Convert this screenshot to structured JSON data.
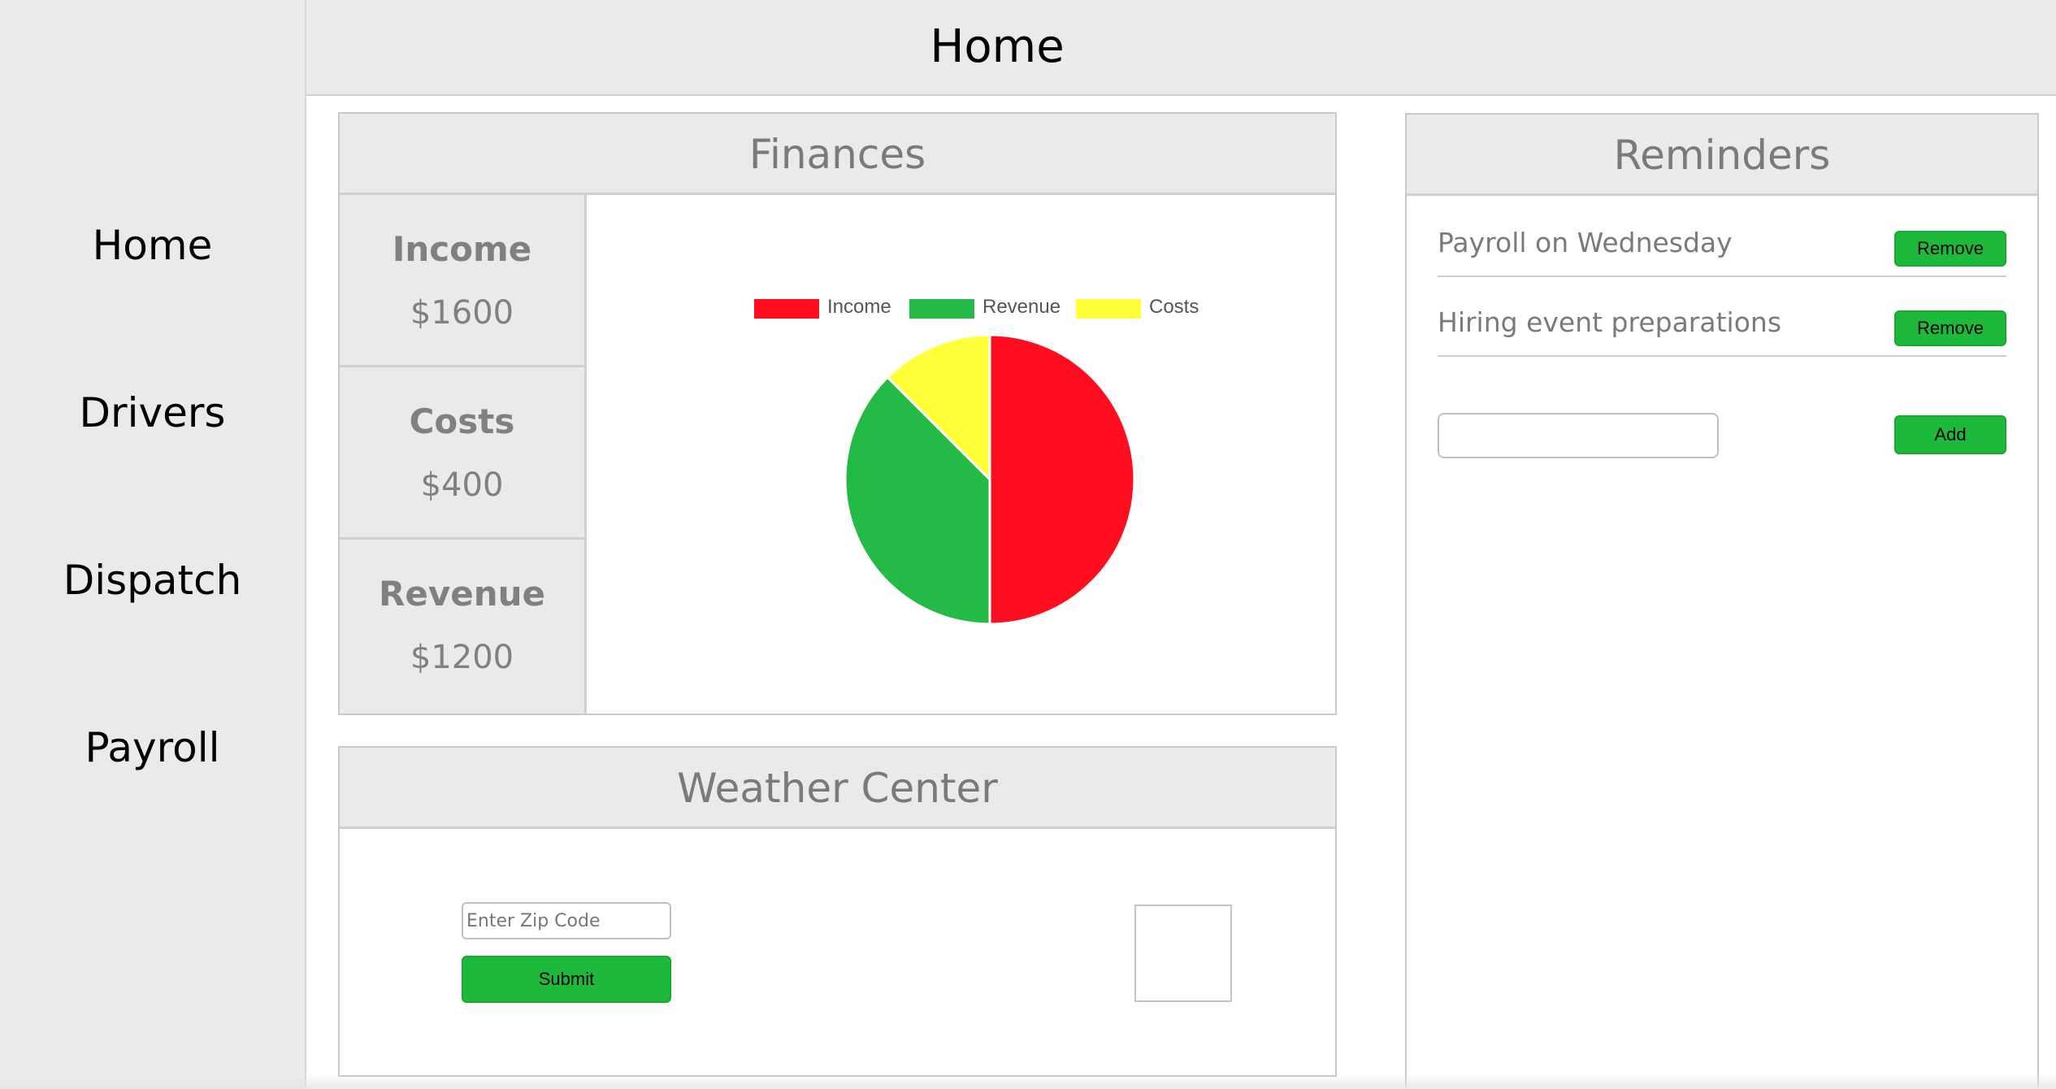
{
  "sidebar": {
    "items": [
      {
        "label": "Home"
      },
      {
        "label": "Drivers"
      },
      {
        "label": "Dispatch"
      },
      {
        "label": "Payroll"
      }
    ]
  },
  "header": {
    "title": "Home"
  },
  "finances": {
    "title": "Finances",
    "stats": [
      {
        "label": "Income",
        "value": "$1600"
      },
      {
        "label": "Costs",
        "value": "$400"
      },
      {
        "label": "Revenue",
        "value": "$1200"
      }
    ]
  },
  "chart_data": {
    "type": "pie",
    "title": "",
    "legend_position": "top",
    "series": [
      {
        "name": "Income",
        "value": 1600,
        "color": "#ff0e1f"
      },
      {
        "name": "Revenue",
        "value": 1200,
        "color": "#23bb45"
      },
      {
        "name": "Costs",
        "value": 400,
        "color": "#ffff3a"
      }
    ]
  },
  "weather": {
    "title": "Weather Center",
    "zip_placeholder": "Enter Zip Code",
    "submit_label": "Submit"
  },
  "reminders": {
    "title": "Reminders",
    "items": [
      {
        "text": "Payroll on Wednesday",
        "action_label": "Remove"
      },
      {
        "text": "Hiring event preparations",
        "action_label": "Remove"
      }
    ],
    "new_value": "",
    "add_label": "Add"
  },
  "colors": {
    "button_green": "#1db93a",
    "panel_header": "#e9eaeb",
    "muted_text": "#7a7a7a"
  }
}
